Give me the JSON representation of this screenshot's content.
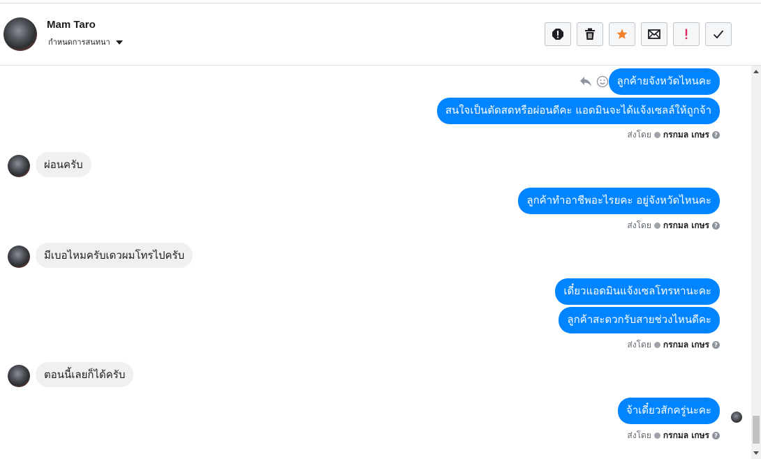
{
  "header": {
    "contact_name": "Mam Taro",
    "assign_label": "กำหนดการสนทนา",
    "actions": [
      {
        "name": "spam-button",
        "icon": "exclamation-circle-icon"
      },
      {
        "name": "delete-button",
        "icon": "trash-icon"
      },
      {
        "name": "star-button",
        "icon": "star-icon"
      },
      {
        "name": "mark-unread-button",
        "icon": "envelope-icon"
      },
      {
        "name": "follow-up-button",
        "icon": "exclamation-icon"
      },
      {
        "name": "done-button",
        "icon": "check-icon"
      }
    ]
  },
  "colors": {
    "outgoing_bubble": "#0084ff",
    "incoming_bubble": "#f1f0f0",
    "star": "#f5812b",
    "flag": "#e0245e"
  },
  "messages": [
    {
      "dir": "out",
      "text": "ลูกค้ายจังหวัดไหนคะ"
    },
    {
      "dir": "out",
      "text": "สนใจเป็นตัดสดหรือผ่อนดีคะ แอดมินจะได้แจ้งเซลล์ให้ถูกจ้า"
    },
    {
      "dir": "in",
      "text": "ผ่อนครับ"
    },
    {
      "dir": "out",
      "text": "ลูกค้าทำอาชีพอะไรยคะ อยู่จังหวัดไหนคะ"
    },
    {
      "dir": "in",
      "text": "มีเบอไหมครับเดวผมโทรไปครับ"
    },
    {
      "dir": "out",
      "text": "เดี๋ยวแอดมินแจ้งเซลโทรหานะคะ"
    },
    {
      "dir": "out",
      "text": "ลูกค้าสะดวกรับสายช่วงไหนดีคะ"
    },
    {
      "dir": "in",
      "text": "ตอนนี้เลยก็ได้ครับ"
    },
    {
      "dir": "out",
      "text": "จ้าเดี๋ยวสักครู่นะคะ"
    }
  ],
  "sent_by": {
    "prefix": "ส่งโดย",
    "agent": "กรกมล เกษร"
  }
}
